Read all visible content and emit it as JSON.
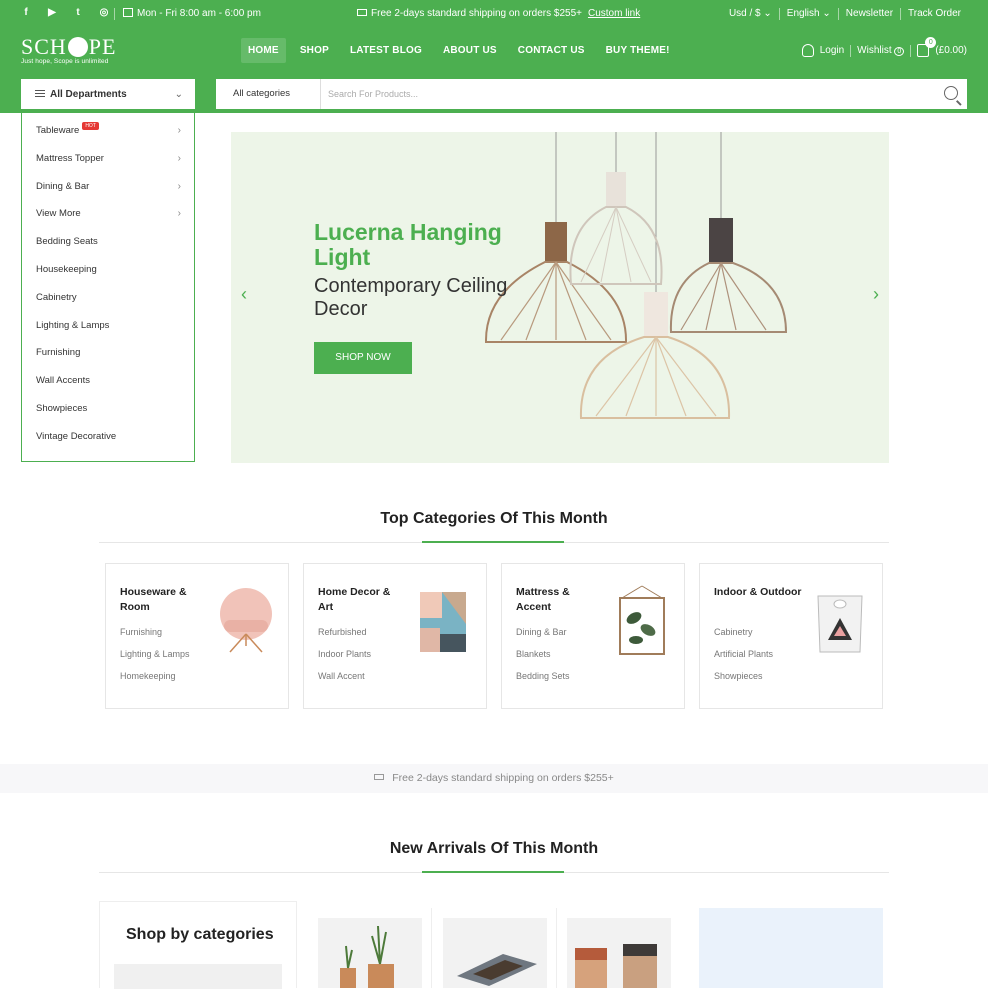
{
  "topbar": {
    "socials": [
      "facebook-icon",
      "youtube-icon",
      "twitter-icon",
      "instagram-icon"
    ],
    "hours": "Mon - Fri 8:00 am - 6:00 pm",
    "promo": "Free 2-days standard shipping on orders $255+",
    "promo_link": "Custom link",
    "currency": "Usd / $",
    "language": "English",
    "newsletter": "Newsletter",
    "track_order": "Track Order"
  },
  "header": {
    "logo_left": "SCH",
    "logo_right": "PE",
    "tagline": "Just hope, Scope is unlimited",
    "nav": [
      "HOME",
      "SHOP",
      "LATEST BLOG",
      "ABOUT US",
      "CONTACT US",
      "BUY THEME!"
    ],
    "login": "Login",
    "wishlist": "Wishlist",
    "wishlist_count": "0",
    "cart_count": "0",
    "cart_total": "(£0.00)"
  },
  "search": {
    "departments": "All Departments",
    "category": "All categories",
    "placeholder": "Search For Products..."
  },
  "menu": {
    "items": [
      "Tableware",
      "Mattress Topper",
      "Dining & Bar",
      "View More",
      "Bedding Seats",
      "Housekeeping",
      "Cabinetry",
      "Lighting & Lamps",
      "Furnishing",
      "Wall Accents",
      "Showpieces",
      "Vintage Decorative"
    ],
    "hot_badge": "HOT"
  },
  "hero": {
    "title": "Lucerna Hanging Light",
    "subtitle": "Contemporary Ceiling Decor",
    "button": "SHOP NOW"
  },
  "top_categories": {
    "title": "Top Categories Of This Month",
    "cards": [
      {
        "title": "Houseware & Room",
        "links": [
          "Furnishing",
          "Lighting & Lamps",
          "Homekeeping"
        ]
      },
      {
        "title": "Home Decor & Art",
        "links": [
          "Refurbished",
          "Indoor Plants",
          "Wall Accent"
        ]
      },
      {
        "title": "Mattress & Accent",
        "links": [
          "Dining & Bar",
          "Blankets",
          "Bedding Sets"
        ]
      },
      {
        "title": "Indoor & Outdoor",
        "links": [
          "Cabinetry",
          "Artificial Plants",
          "Showpieces"
        ]
      }
    ]
  },
  "shipping_bar": "Free 2-days standard shipping on orders $255+",
  "new_arrivals": {
    "title": "New Arrivals Of This Month",
    "shop_by": "Shop by categories"
  },
  "colors": {
    "brand": "#4caf50",
    "hot": "#e53935"
  }
}
